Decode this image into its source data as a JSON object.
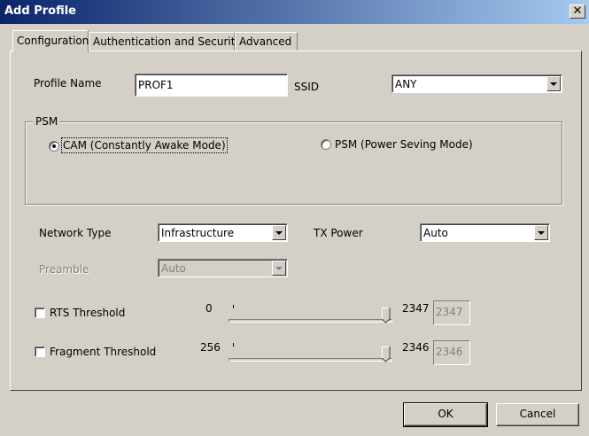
{
  "window": {
    "title": "Add Profile",
    "close_label": "✕"
  },
  "tabs": [
    {
      "label": "Configuration",
      "active": true
    },
    {
      "label": "Authentication and Security",
      "active": false
    },
    {
      "label": "Advanced",
      "active": false
    }
  ],
  "profile": {
    "name_label": "Profile Name",
    "name_value": "PROF1",
    "ssid_label": "SSID",
    "ssid_value": "ANY"
  },
  "psm": {
    "legend": "PSM",
    "cam_label": "CAM (Constantly Awake Mode)",
    "psm_label": "PSM (Power Seving Mode)",
    "selected": "cam"
  },
  "network": {
    "type_label": "Network Type",
    "type_value": "Infrastructure",
    "txpower_label": "TX Power",
    "txpower_value": "Auto",
    "preamble_label": "Preamble",
    "preamble_value": "Auto"
  },
  "rts": {
    "label": "RTS Threshold",
    "min": "0",
    "max": "2347",
    "value": "2347",
    "checked": false,
    "level": 1.0
  },
  "fragment": {
    "label": "Fragment Threshold",
    "min": "256",
    "max": "2346",
    "value": "2346",
    "checked": false,
    "level": 1.0
  },
  "buttons": {
    "ok": "OK",
    "cancel": "Cancel"
  }
}
